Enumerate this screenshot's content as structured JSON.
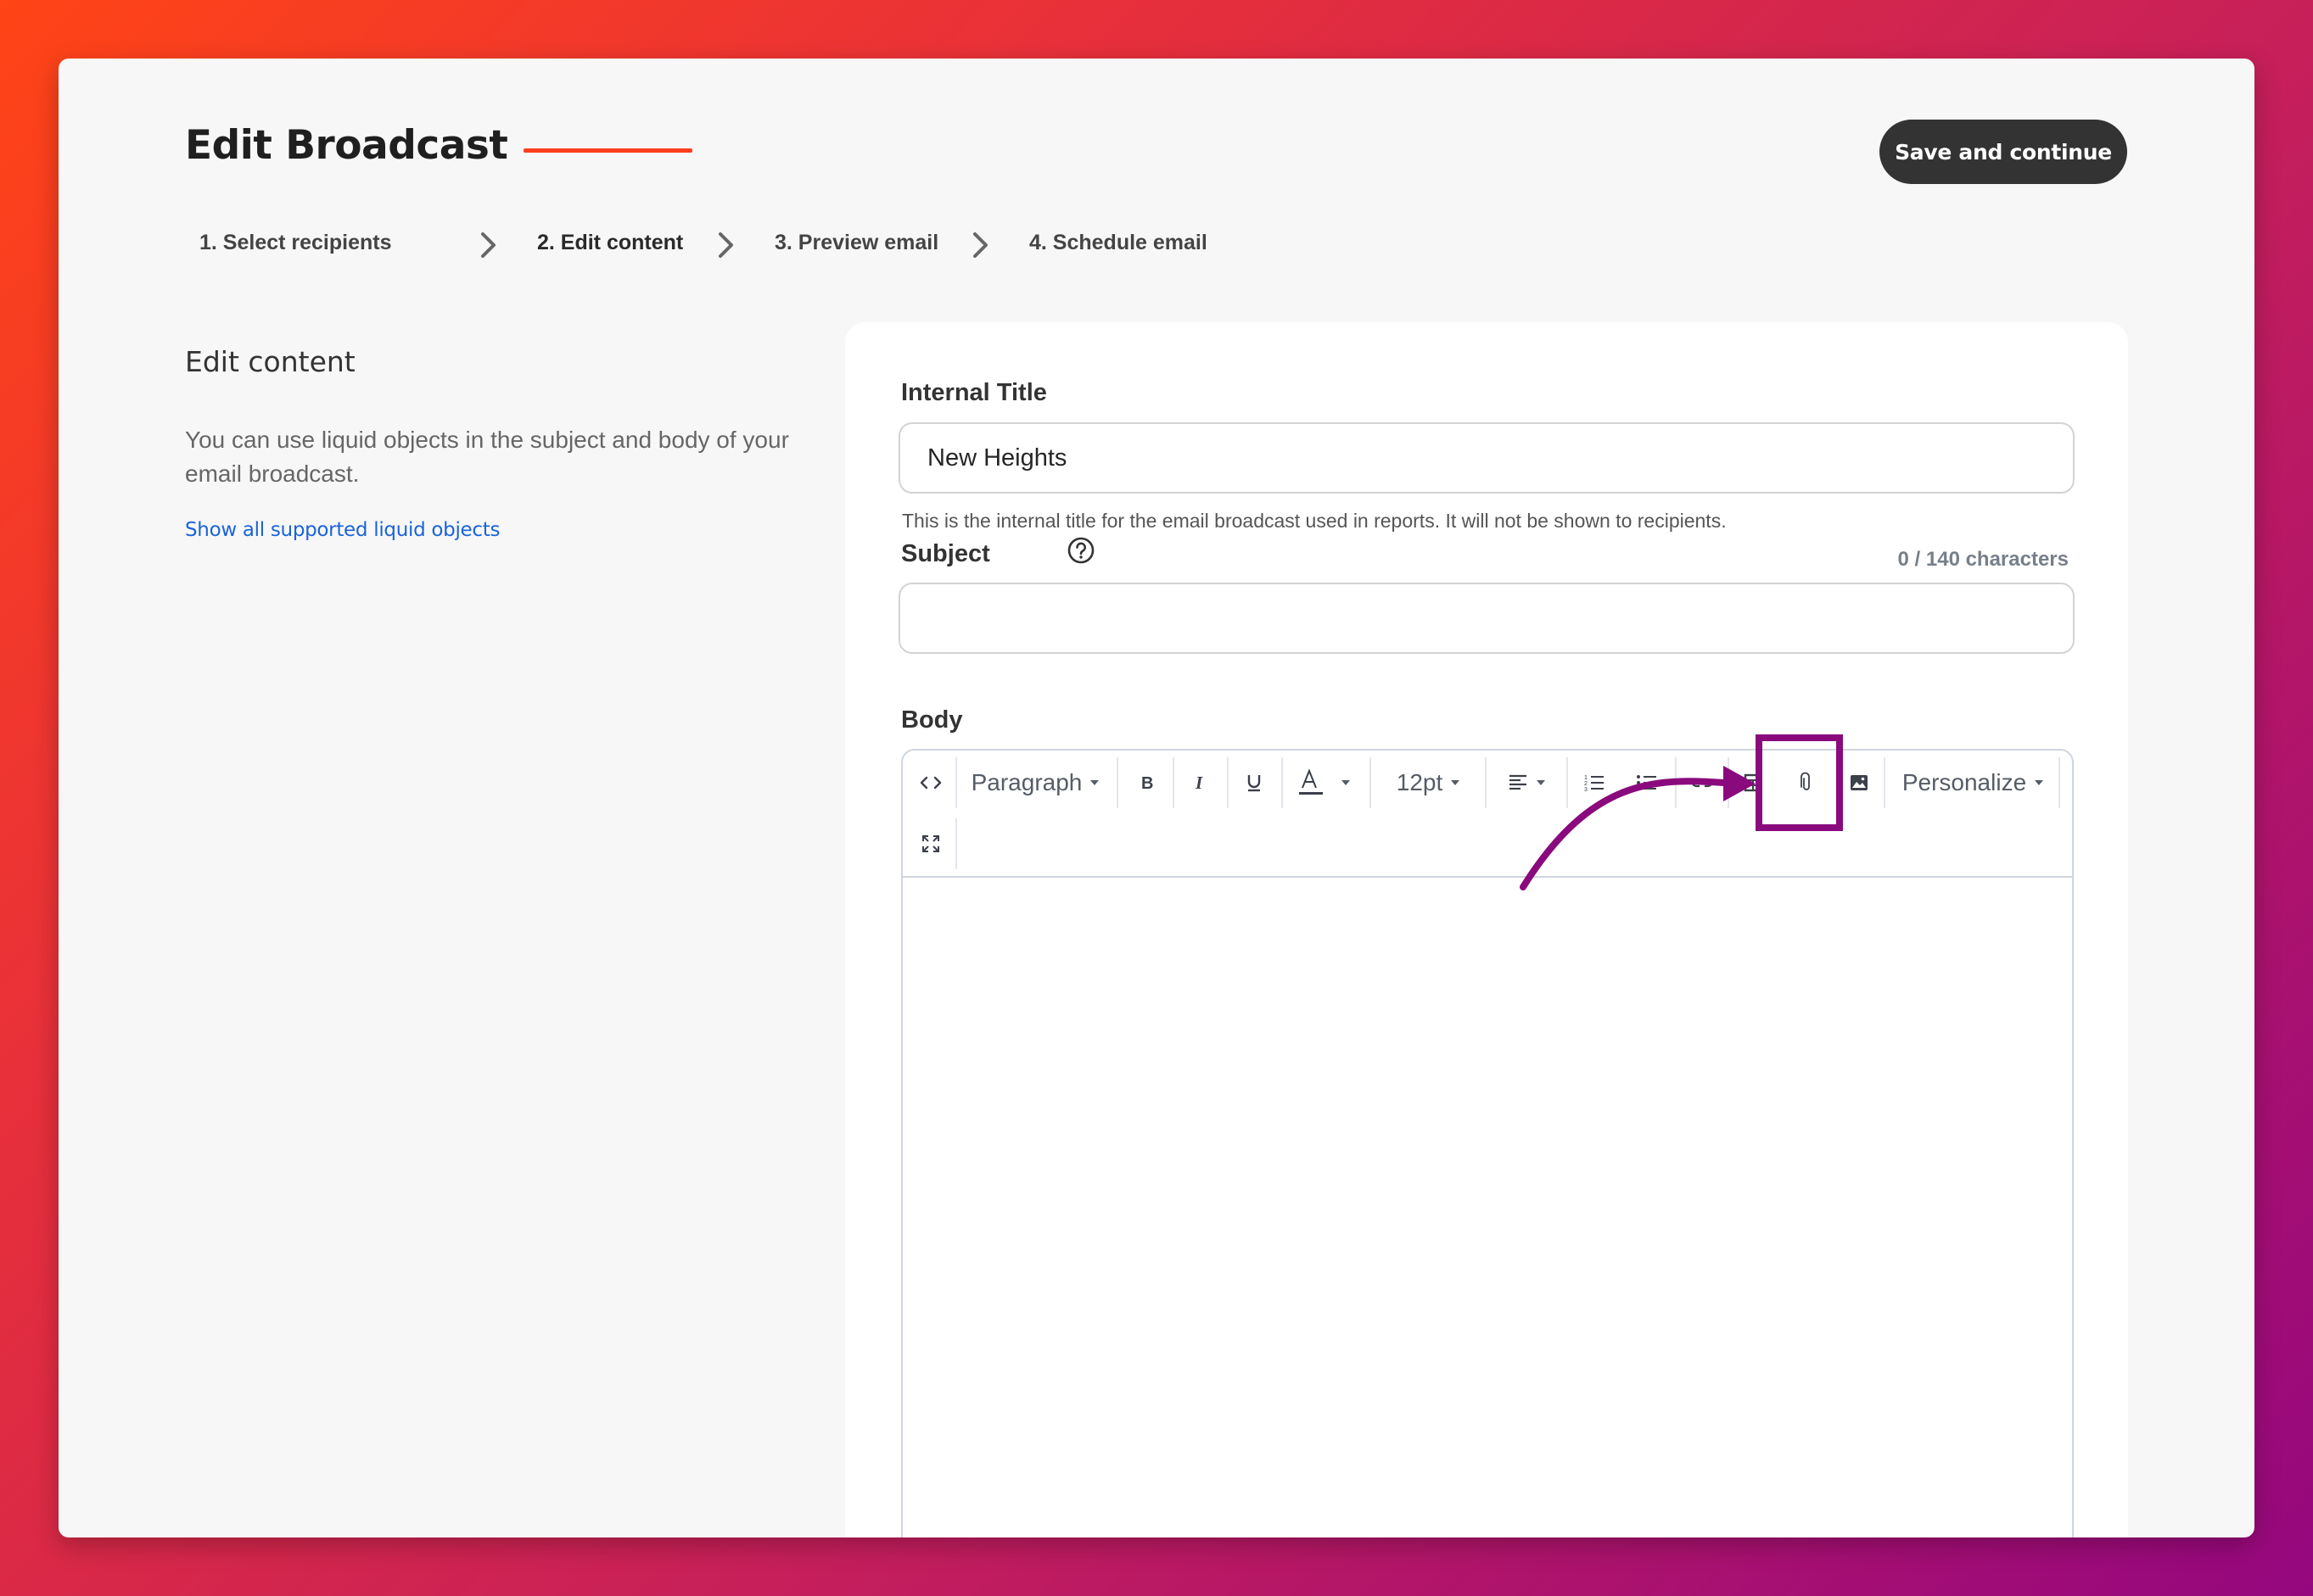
{
  "header": {
    "title": "Edit Broadcast",
    "save_label": "Save and continue"
  },
  "steps": [
    {
      "label": "1. Select recipients"
    },
    {
      "label": "2. Edit content"
    },
    {
      "label": "3. Preview email"
    },
    {
      "label": "4. Schedule email"
    }
  ],
  "sidebar": {
    "heading": "Edit content",
    "description": "You can use liquid objects in the subject and body of your email broadcast.",
    "link": "Show all supported liquid objects"
  },
  "form": {
    "internal_title_label": "Internal Title",
    "internal_title_value": "New Heights",
    "internal_title_hint": "This is the internal title for the email broadcast used in reports. It will not be shown to recipients.",
    "subject_label": "Subject",
    "subject_value": "",
    "subject_count": "0 / 140 characters",
    "body_label": "Body"
  },
  "toolbar": {
    "block_format": "Paragraph",
    "font_size": "12pt",
    "personalize": "Personalize"
  },
  "colors": {
    "accent": "#ff3d1f",
    "link": "#1a63d8",
    "annotation": "#8a0a7e",
    "button": "#333333"
  },
  "icons": [
    "source-code-icon",
    "bold-icon",
    "italic-icon",
    "underline-icon",
    "text-color-icon",
    "align-left-icon",
    "numbered-list-icon",
    "bulleted-list-icon",
    "link-icon",
    "table-icon",
    "attachment-icon",
    "image-icon",
    "fullscreen-icon",
    "help-icon",
    "chevron-right-icon"
  ]
}
